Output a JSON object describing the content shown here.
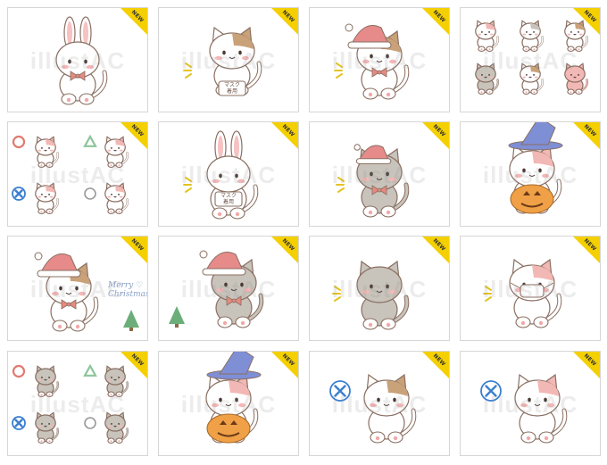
{
  "badge_label": "NEW",
  "watermark": "illustAC",
  "merry_christmas_text": [
    "Merry",
    "Christmas"
  ],
  "mask_text": [
    "マスク",
    "着用"
  ],
  "colors": {
    "badge": "#f5d000",
    "border": "#d6d6d6",
    "cat_calico_brown": "#c9a27a",
    "cat_gray": "#c8c3bb",
    "cat_pink": "#f2b8b5",
    "santa_hat": "#e68a8a",
    "witch_hat": "#7f8fd6",
    "pumpkin": "#f0a046",
    "bow": "#e58a80",
    "circle_mark": "#e07a70",
    "triangle_mark": "#8cc59a",
    "cross_mark": "#3b7fd0"
  },
  "thumbnails": [
    {
      "subject": "rabbit with bow tie",
      "icon": "rabbit-icon"
    },
    {
      "subject": "calico cat with mask sign",
      "icon": "cat-mask-icon"
    },
    {
      "subject": "calico cat with santa hat",
      "icon": "cat-santa-icon"
    },
    {
      "subject": "set of six cats",
      "icon": "cat-set-icon"
    },
    {
      "subject": "cats with circle triangle cross marks",
      "icon": "cat-marks-icon"
    },
    {
      "subject": "rabbit with mask sign",
      "icon": "rabbit-mask-icon"
    },
    {
      "subject": "gray cat with santa hat",
      "icon": "cat-santa-icon"
    },
    {
      "subject": "pink cat with witch hat and pumpkin",
      "icon": "cat-halloween-icon"
    },
    {
      "subject": "calico cat christmas card",
      "icon": "cat-christmas-icon"
    },
    {
      "subject": "gray cat christmas card",
      "icon": "cat-christmas-icon"
    },
    {
      "subject": "gray cat waving",
      "icon": "cat-icon"
    },
    {
      "subject": "pink cat with mask",
      "icon": "cat-mask-icon"
    },
    {
      "subject": "gray cats with marks",
      "icon": "cat-marks-icon"
    },
    {
      "subject": "pink cat halloween",
      "icon": "cat-halloween-icon"
    },
    {
      "subject": "calico cat with cross sign",
      "icon": "cat-cross-icon"
    },
    {
      "subject": "pink cat with cross sign",
      "icon": "cat-cross-icon"
    }
  ]
}
